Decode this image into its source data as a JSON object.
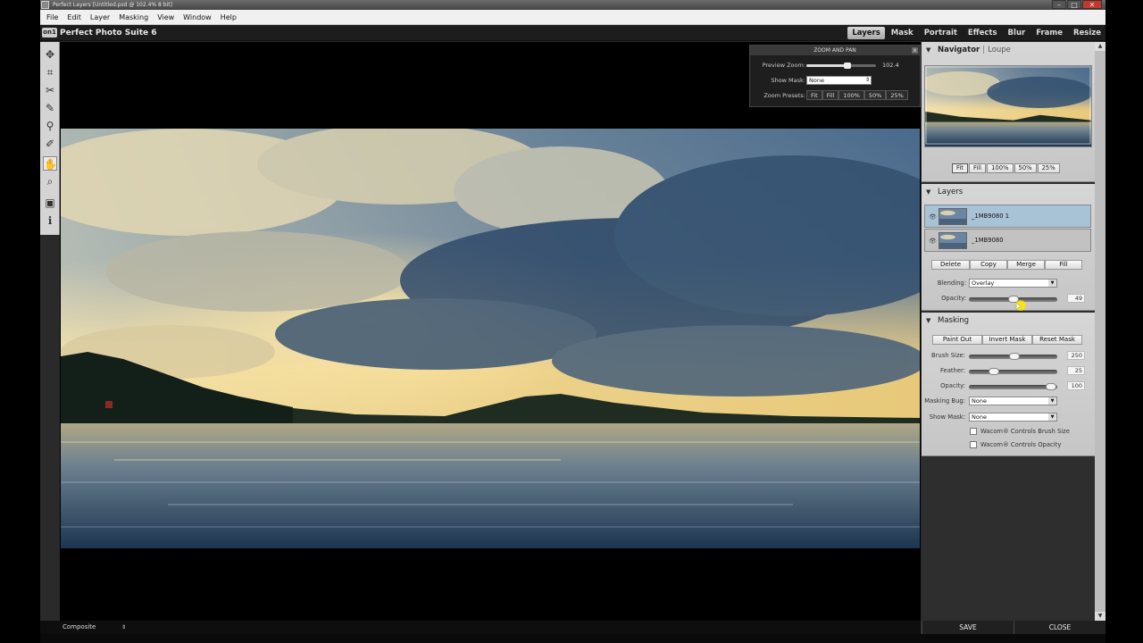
{
  "window": {
    "title": "Perfect Layers [Untitled.psd @ 102.4% 8 bit]",
    "controls": {
      "minimize": "–",
      "maximize": "□",
      "close": "✕"
    }
  },
  "menu": [
    "File",
    "Edit",
    "Layer",
    "Masking",
    "View",
    "Window",
    "Help"
  ],
  "app": {
    "logo": "on1",
    "title": "Perfect Photo Suite 6",
    "modules": [
      "Layers",
      "Mask",
      "Portrait",
      "Effects",
      "Blur",
      "Frame",
      "Resize"
    ],
    "active_module": "Layers"
  },
  "tools": [
    {
      "name": "move-icon",
      "glyph": "✥"
    },
    {
      "name": "crop-icon",
      "glyph": "⌗"
    },
    {
      "name": "scissors-icon",
      "glyph": "✂"
    },
    {
      "name": "brush-icon",
      "glyph": "✎"
    },
    {
      "name": "stamp-icon",
      "glyph": "⚲"
    },
    {
      "name": "eyedropper-icon",
      "glyph": "✐"
    },
    {
      "name": "hand-icon",
      "glyph": "✋"
    },
    {
      "name": "zoom-icon",
      "glyph": "⌕"
    },
    {
      "name": "preview-icon",
      "glyph": "▣"
    },
    {
      "name": "info-icon",
      "glyph": "ℹ"
    }
  ],
  "zoom_pan": {
    "title": "ZOOM AND PAN",
    "close": "x",
    "preview_zoom_label": "Preview Zoom:",
    "preview_zoom_value": "102.4",
    "show_mask_label": "Show Mask:",
    "show_mask_value": "None",
    "zoom_presets_label": "Zoom Presets:",
    "presets": [
      "Fit",
      "Fill",
      "100%",
      "50%",
      "25%"
    ]
  },
  "navigator": {
    "title": "Navigator",
    "sep": "|",
    "loupe": "Loupe",
    "buttons": [
      "Fit",
      "Fill",
      "100%",
      "50%",
      "25%"
    ],
    "active": "Fit"
  },
  "layers": {
    "title": "Layers",
    "items": [
      {
        "name": "_1MB9080 1",
        "selected": true
      },
      {
        "name": "_1MB9080",
        "selected": false
      }
    ],
    "actions": [
      "Delete",
      "Copy",
      "Merge",
      "Fill"
    ],
    "blending_label": "Blending:",
    "blending_value": "Overlay",
    "opacity_label": "Opacity:",
    "opacity_value": "49"
  },
  "masking": {
    "title": "Masking",
    "actions": [
      "Paint Out",
      "Invert Mask",
      "Reset Mask"
    ],
    "brush_size_label": "Brush Size:",
    "brush_size_value": "250",
    "feather_label": "Feather:",
    "feather_value": "25",
    "opacity_label": "Opacity:",
    "opacity_value": "100",
    "masking_bug_label": "Masking Bug:",
    "masking_bug_value": "None",
    "show_mask_label": "Show Mask:",
    "show_mask_value": "None",
    "wacom_brush": "Wacom® Controls Brush Size",
    "wacom_opacity": "Wacom® Controls Opacity"
  },
  "status": {
    "view_mode": "Composite"
  },
  "footer": {
    "save": "SAVE",
    "close": "CLOSE"
  },
  "colors": {
    "selected_layer": "#a9c3d6",
    "accent_cursor": "#ffe600"
  }
}
